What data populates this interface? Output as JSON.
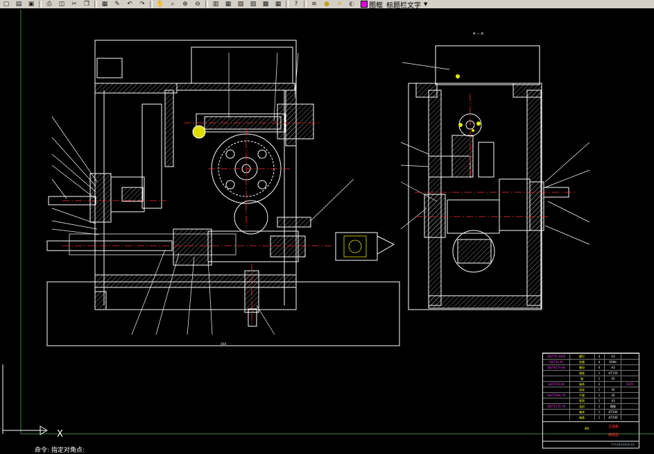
{
  "toolbar": {
    "layer_name": "图框_标题栏文字",
    "icons": [
      "new-icon",
      "open-icon",
      "save-icon",
      "print-icon",
      "preview-icon",
      "cut-icon",
      "copy-icon",
      "paste-icon",
      "match-icon",
      "undo-icon",
      "redo-icon",
      "pan-icon",
      "zoom-realtime-icon",
      "zoom-window-icon",
      "zoom-previous-icon",
      "properties-icon",
      "design-center-icon",
      "tool-palette-icon",
      "sheet-set-icon",
      "markup-icon",
      "calc-icon",
      "help-icon",
      "layer-manager-icon",
      "layer-on-icon",
      "layer-freeze-icon",
      "layer-lock-icon"
    ]
  },
  "drawing": {
    "section_label": "A — A",
    "dimension_bottom": "XXX"
  },
  "title_block": {
    "parts": [
      {
        "code": "GB/T70-2000",
        "name": "螺钉",
        "qty": "4",
        "mat": "A3",
        "rem": ""
      },
      {
        "code": "GB/T93-87",
        "name": "垫圈",
        "qty": "4",
        "mat": "65Mn",
        "rem": ""
      },
      {
        "code": "GB/T6170-86",
        "name": "螺母",
        "qty": "4",
        "mat": "A3",
        "rem": ""
      },
      {
        "code": "",
        "name": "端盖",
        "qty": "1",
        "mat": "HT150",
        "rem": ""
      },
      {
        "code": "",
        "name": "轴",
        "qty": "1",
        "mat": "45",
        "rem": ""
      },
      {
        "code": "GB/T276-94",
        "name": "轴承",
        "qty": "2",
        "mat": "",
        "rem": "6205"
      },
      {
        "code": "",
        "name": "齿轮",
        "qty": "1",
        "mat": "45",
        "rem": ""
      },
      {
        "code": "GB/T1096-79",
        "name": "平键",
        "qty": "1",
        "mat": "45",
        "rem": ""
      },
      {
        "code": "",
        "name": "套筒",
        "qty": "1",
        "mat": "A3",
        "rem": ""
      },
      {
        "code": "GB/T1235-76",
        "name": "油封",
        "qty": "1",
        "mat": "橡胶",
        "rem": ""
      },
      {
        "code": "",
        "name": "箱体",
        "qty": "1",
        "mat": "HT200",
        "rem": ""
      },
      {
        "code": "",
        "name": "箱盖",
        "qty": "1",
        "mat": "HT200",
        "rem": ""
      }
    ],
    "scale": "A0",
    "title": "主轴箱",
    "subtitle": "装配图",
    "footer": "YYY-XXXXXXX-XX"
  },
  "ucs": {
    "x_label": "X"
  },
  "command": {
    "text": "命令: 指定对角点:"
  }
}
